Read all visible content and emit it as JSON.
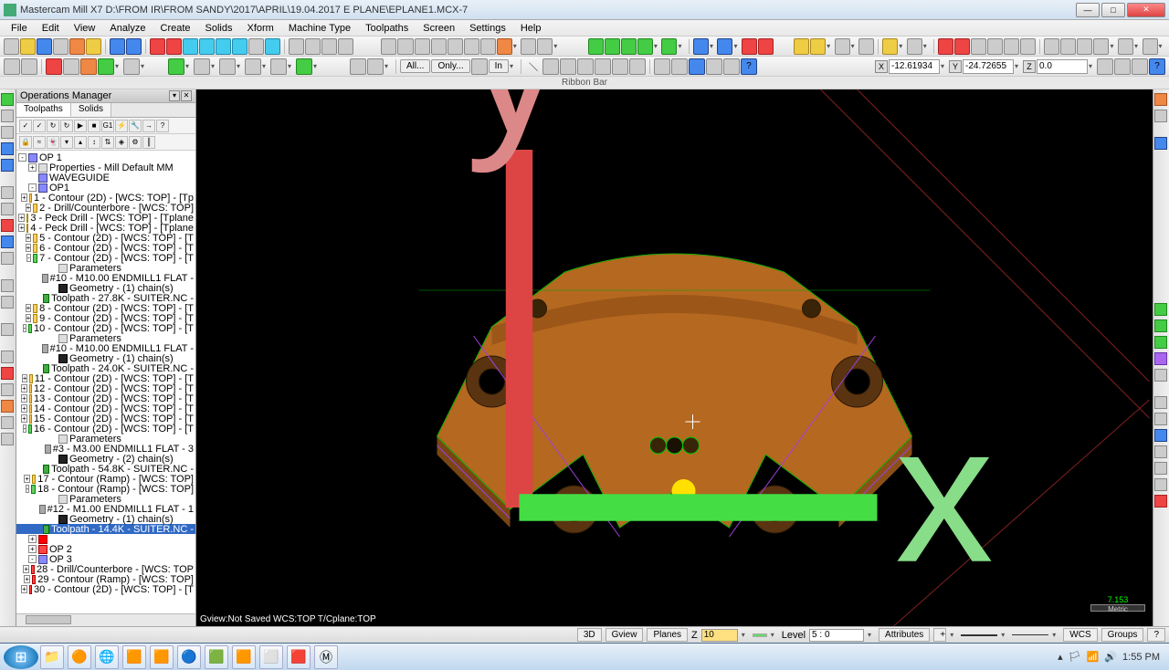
{
  "title": "Mastercam Mill X7   D:\\FROM IR\\FROM SANDY\\2017\\APRIL\\19.04.2017 E PLANE\\EPLANE1.MCX-7",
  "menus": [
    "File",
    "Edit",
    "View",
    "Analyze",
    "Create",
    "Solids",
    "Xform",
    "Machine Type",
    "Toolpaths",
    "Screen",
    "Settings",
    "Help"
  ],
  "ribbon_label": "Ribbon Bar",
  "coords": {
    "x_label": "X",
    "x_val": "-12.61934",
    "y_label": "Y",
    "y_val": "-24.72655",
    "z_label": "Z",
    "z_val": "0.0"
  },
  "filters": {
    "all": "All...",
    "only": "Only...",
    "in": "In"
  },
  "ops": {
    "title": "Operations Manager",
    "tabs": [
      "Toolpaths",
      "Solids"
    ],
    "tree": [
      {
        "d": 0,
        "exp": "-",
        "icon": "gear",
        "label": "OP 1"
      },
      {
        "d": 1,
        "exp": "+",
        "icon": "param",
        "label": "Properties - Mill Default MM"
      },
      {
        "d": 1,
        "exp": "",
        "icon": "gear",
        "label": "WAVEGUIDE"
      },
      {
        "d": 1,
        "exp": "-",
        "icon": "gear",
        "label": "OP1"
      },
      {
        "d": 2,
        "exp": "+",
        "icon": "folder",
        "label": "1 - Contour (2D) - [WCS: TOP] - [Tp"
      },
      {
        "d": 2,
        "exp": "+",
        "icon": "folder",
        "label": "2 - Drill/Counterbore - [WCS: TOP]"
      },
      {
        "d": 2,
        "exp": "+",
        "icon": "folder",
        "label": "3 - Peck Drill - [WCS: TOP] - [Tplane"
      },
      {
        "d": 2,
        "exp": "+",
        "icon": "folder",
        "label": "4 - Peck Drill - [WCS: TOP] - [Tplane"
      },
      {
        "d": 2,
        "exp": "+",
        "icon": "folder",
        "label": "5 - Contour (2D) - [WCS: TOP] - [T"
      },
      {
        "d": 2,
        "exp": "+",
        "icon": "folder",
        "label": "6 - Contour (2D) - [WCS: TOP] - [T"
      },
      {
        "d": 2,
        "exp": "-",
        "icon": "folder-g",
        "label": "7 - Contour (2D) - [WCS: TOP] - [T"
      },
      {
        "d": 3,
        "exp": "",
        "icon": "param",
        "label": "Parameters"
      },
      {
        "d": 3,
        "exp": "",
        "icon": "tool",
        "label": "#10 - M10.00 ENDMILL1 FLAT -"
      },
      {
        "d": 3,
        "exp": "",
        "icon": "geom",
        "label": "Geometry - (1) chain(s)"
      },
      {
        "d": 3,
        "exp": "",
        "icon": "tp",
        "label": "Toolpath - 27.8K - SUITER.NC -"
      },
      {
        "d": 2,
        "exp": "+",
        "icon": "folder",
        "label": "8 - Contour (2D) - [WCS: TOP] - [T"
      },
      {
        "d": 2,
        "exp": "+",
        "icon": "folder",
        "label": "9 - Contour (2D) - [WCS: TOP] - [T"
      },
      {
        "d": 2,
        "exp": "-",
        "icon": "folder-g",
        "label": "10 - Contour (2D) - [WCS: TOP] - [T"
      },
      {
        "d": 3,
        "exp": "",
        "icon": "param",
        "label": "Parameters"
      },
      {
        "d": 3,
        "exp": "",
        "icon": "tool",
        "label": "#10 - M10.00 ENDMILL1 FLAT -"
      },
      {
        "d": 3,
        "exp": "",
        "icon": "geom",
        "label": "Geometry - (1) chain(s)"
      },
      {
        "d": 3,
        "exp": "",
        "icon": "tp",
        "label": "Toolpath - 24.0K - SUITER.NC -"
      },
      {
        "d": 2,
        "exp": "+",
        "icon": "folder",
        "label": "11 - Contour (2D) - [WCS: TOP] - [T"
      },
      {
        "d": 2,
        "exp": "+",
        "icon": "folder",
        "label": "12 - Contour (2D) - [WCS: TOP] - [T"
      },
      {
        "d": 2,
        "exp": "+",
        "icon": "folder",
        "label": "13 - Contour (2D) - [WCS: TOP] - [T"
      },
      {
        "d": 2,
        "exp": "+",
        "icon": "folder",
        "label": "14 - Contour (2D) - [WCS: TOP] - [T"
      },
      {
        "d": 2,
        "exp": "+",
        "icon": "folder",
        "label": "15 - Contour (2D) - [WCS: TOP] - [T"
      },
      {
        "d": 2,
        "exp": "-",
        "icon": "folder-g",
        "label": "16 - Contour (2D) - [WCS: TOP] - [T"
      },
      {
        "d": 3,
        "exp": "",
        "icon": "param",
        "label": "Parameters"
      },
      {
        "d": 3,
        "exp": "",
        "icon": "tool",
        "label": "#3 - M3.00 ENDMILL1 FLAT - 3"
      },
      {
        "d": 3,
        "exp": "",
        "icon": "geom",
        "label": "Geometry - (2) chain(s)"
      },
      {
        "d": 3,
        "exp": "",
        "icon": "tp",
        "label": "Toolpath - 54.8K - SUITER.NC -"
      },
      {
        "d": 2,
        "exp": "+",
        "icon": "folder",
        "label": "17 - Contour (Ramp) - [WCS: TOP]"
      },
      {
        "d": 2,
        "exp": "-",
        "icon": "folder-g",
        "label": "18 - Contour (Ramp) - [WCS: TOP]"
      },
      {
        "d": 3,
        "exp": "",
        "icon": "param",
        "label": "Parameters"
      },
      {
        "d": 3,
        "exp": "",
        "icon": "tool",
        "label": "#12 - M1.00 ENDMILL1 FLAT - 1"
      },
      {
        "d": 3,
        "exp": "",
        "icon": "geom",
        "label": "Geometry - (1) chain(s)"
      },
      {
        "d": 3,
        "exp": "",
        "icon": "tp",
        "label": "Toolpath - 14.4K - SUITER.NC -",
        "sel": true
      },
      {
        "d": 1,
        "exp": "+",
        "icon": "arrow",
        "label": ""
      },
      {
        "d": 1,
        "exp": "+",
        "icon": "red",
        "label": "OP 2"
      },
      {
        "d": 1,
        "exp": "-",
        "icon": "gear",
        "label": "OP 3"
      },
      {
        "d": 2,
        "exp": "+",
        "icon": "red",
        "label": "28 - Drill/Counterbore - [WCS: TOP"
      },
      {
        "d": 2,
        "exp": "+",
        "icon": "red",
        "label": "29 - Contour (Ramp) - [WCS: TOP]"
      },
      {
        "d": 2,
        "exp": "+",
        "icon": "red",
        "label": "30 - Contour (2D) - [WCS: TOP] - [T"
      }
    ]
  },
  "viewport": {
    "overlay": "Gview:Not Saved   WCS:TOP   T/Cplane:TOP",
    "scale_value": "7.153",
    "scale_unit": "Metric",
    "axis_y": "y",
    "axis_x": "x"
  },
  "statusbar": {
    "mode": "3D",
    "gview": "Gview",
    "planes": "Planes",
    "z": "Z",
    "z_val": "10",
    "level": "Level",
    "level_val": "5 : 0",
    "attributes": "Attributes",
    "wcs": "WCS",
    "groups": "Groups",
    "question": "?"
  },
  "taskbar": {
    "time": "1:55 PM"
  }
}
